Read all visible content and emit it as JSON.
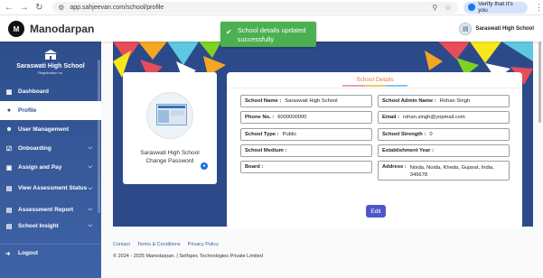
{
  "browser": {
    "url": "app.sahjeevan.com/school/profile",
    "verify_chip": "Verify that it's you"
  },
  "header": {
    "app_title": "Manodarpan",
    "logo_text": "M",
    "school_name": "Saraswati High School"
  },
  "toast": {
    "message": "School details updated successfully"
  },
  "sidebar": {
    "brand_name": "Saraswati High School",
    "brand_sub": "Registration no.",
    "items": [
      {
        "label": "Dashboard",
        "icon": "dashboard-icon",
        "chevron": false,
        "active": false
      },
      {
        "label": "Profile",
        "icon": "person-icon",
        "chevron": false,
        "active": true
      },
      {
        "label": "User Management",
        "icon": "user-management-icon",
        "chevron": false,
        "active": false
      },
      {
        "label": "Onboarding",
        "icon": "onboarding-icon",
        "chevron": true,
        "active": false
      },
      {
        "label": "Assign and Pay",
        "icon": "assign-pay-icon",
        "chevron": true,
        "active": false
      },
      {
        "label": "View Assessment Status",
        "icon": "assessment-status-icon",
        "chevron": true,
        "active": false
      },
      {
        "label": "Assessment Report",
        "icon": "report-icon",
        "chevron": true,
        "active": false
      },
      {
        "label": "School Insight",
        "icon": "insight-icon",
        "chevron": true,
        "active": false
      }
    ],
    "logout_label": "Logout"
  },
  "profile_card": {
    "school_name": "Saraswati High School",
    "change_password": "Change Password"
  },
  "details": {
    "tab_label": "School Details",
    "fields": {
      "school_name": {
        "label": "School Name :",
        "value": "Saraswati High School"
      },
      "admin_name": {
        "label": "School Admin Name :",
        "value": "Rohan Singh"
      },
      "phone": {
        "label": "Phone No. :",
        "value": "6000000000"
      },
      "email": {
        "label": "Email :",
        "value": "rohan.singh@yopmail.com"
      },
      "school_type": {
        "label": "School Type :",
        "value": "Public"
      },
      "school_strength": {
        "label": "School Strength :",
        "value": "0"
      },
      "school_medium": {
        "label": "School Medium :",
        "value": ""
      },
      "establishment_year": {
        "label": "Establishment Year :",
        "value": ""
      },
      "board": {
        "label": "Board :",
        "value": ""
      },
      "address": {
        "label": "Address :",
        "value": "Noida, Noida, Kheda, Gujarat, India, 345678"
      }
    },
    "edit_label": "Edit"
  },
  "footer": {
    "links": [
      "Contact",
      "Terms & Conditions",
      "Privacy Policy"
    ],
    "copyright": "© 2024 - 2025 Manodarpan. | Selfspec Technologies Private Limited"
  }
}
